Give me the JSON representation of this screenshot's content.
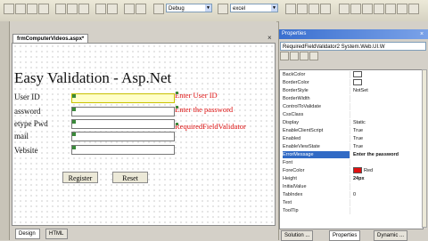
{
  "toolbar": {
    "config_value": "Debug",
    "project_value": "excel"
  },
  "designer": {
    "tab_title": "frmComputerVideos.aspx*",
    "close_glyph": "×",
    "page_heading": "Easy Validation - Asp.Net",
    "fields": [
      {
        "label": "User ID"
      },
      {
        "label": "assword"
      },
      {
        "label": "etype Pwd"
      },
      {
        "label": "mail"
      },
      {
        "label": "Vebsite"
      }
    ],
    "validators": [
      {
        "text": "Enter User ID"
      },
      {
        "text": "Enter the password"
      },
      {
        "text": "RequiredFieldValidator"
      }
    ],
    "register_label": "Register",
    "reset_label": "Reset",
    "design_tab": "Design",
    "html_tab": "HTML"
  },
  "properties": {
    "title": "Properties",
    "close_glyph": "×",
    "object_name": "RequiredFieldValidator2  System.Web.UI.W",
    "rows": [
      {
        "name": "BackColor",
        "value": "",
        "swatch": "#ffffff"
      },
      {
        "name": "BorderColor",
        "value": "",
        "swatch": "#ffffff"
      },
      {
        "name": "BorderStyle",
        "value": "NotSet"
      },
      {
        "name": "BorderWidth",
        "value": ""
      },
      {
        "name": "ControlToValidate",
        "value": ""
      },
      {
        "name": "CssClass",
        "value": ""
      },
      {
        "name": "Display",
        "value": "Static"
      },
      {
        "name": "EnableClientScript",
        "value": "True"
      },
      {
        "name": "Enabled",
        "value": "True"
      },
      {
        "name": "EnableViewState",
        "value": "True"
      },
      {
        "name": "ErrorMessage",
        "value": "Enter the password",
        "selected": true
      },
      {
        "name": "Font",
        "value": ""
      },
      {
        "name": "ForeColor",
        "value": "Red",
        "swatch": "#e01010"
      },
      {
        "name": "Height",
        "value": "24px"
      },
      {
        "name": "InitialValue",
        "value": ""
      },
      {
        "name": "TabIndex",
        "value": "0"
      },
      {
        "name": "Text",
        "value": ""
      },
      {
        "name": "ToolTip",
        "value": ""
      }
    ],
    "bottom_tabs": [
      "Solution ...",
      "Properties",
      "Dynamic ..."
    ]
  },
  "colors": {
    "validator_red": "#dd1111",
    "selection_blue": "#316ac5"
  }
}
